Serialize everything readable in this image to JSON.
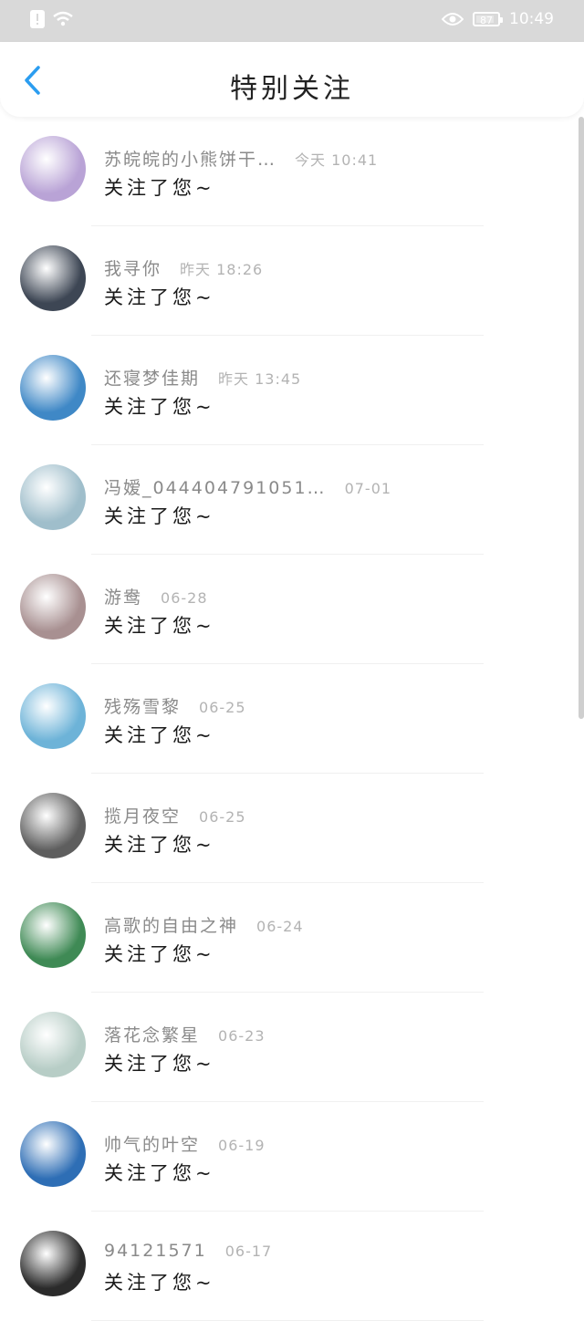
{
  "status_bar": {
    "time": "10:49",
    "battery": "87",
    "battery_level": 0.87
  },
  "header": {
    "title": "特别关注"
  },
  "items": [
    {
      "name": "苏皖皖的小熊饼干…",
      "time": "今天 10:41",
      "message": "关注了您~",
      "avatar_color": "#b9a3d6"
    },
    {
      "name": "我寻你",
      "time": "昨天 18:26",
      "message": "关注了您~",
      "avatar_color": "#3d4654"
    },
    {
      "name": "还寝梦佳期",
      "time": "昨天 13:45",
      "message": "关注了您~",
      "avatar_color": "#3f88c6"
    },
    {
      "name": "冯嫒_044404791051…",
      "time": "07-01",
      "message": "关注了您~",
      "avatar_color": "#9fbecb"
    },
    {
      "name": "游鸯",
      "time": "06-28",
      "message": "关注了您~",
      "avatar_color": "#a89091"
    },
    {
      "name": "残殇雪黎",
      "time": "06-25",
      "message": "关注了您~",
      "avatar_color": "#6db3d8"
    },
    {
      "name": "揽月夜空",
      "time": "06-25",
      "message": "关注了您~",
      "avatar_color": "#5e5e5e"
    },
    {
      "name": "高歌的自由之神",
      "time": "06-24",
      "message": "关注了您~",
      "avatar_color": "#3f8a55"
    },
    {
      "name": "落花念繁星",
      "time": "06-23",
      "message": "关注了您~",
      "avatar_color": "#b7cdc6"
    },
    {
      "name": "帅气的叶空",
      "time": "06-19",
      "message": "关注了您~",
      "avatar_color": "#2e6eb5"
    },
    {
      "name": "94121571",
      "time": "06-17",
      "message": "关注了您~",
      "avatar_color": "#2b2b2b"
    }
  ]
}
